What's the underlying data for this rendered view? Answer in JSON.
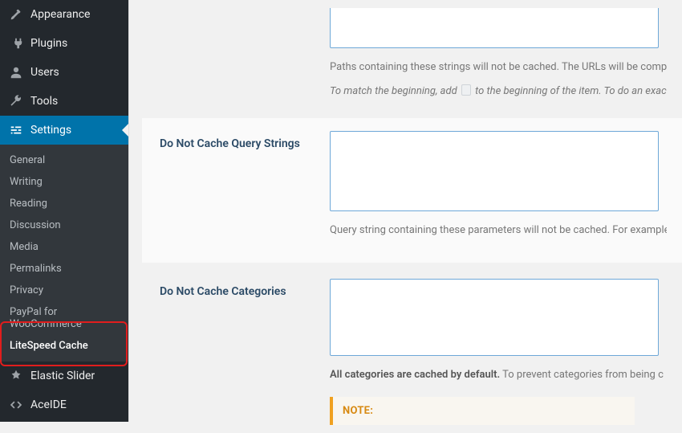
{
  "sidebar": {
    "items": [
      {
        "label": "Appearance",
        "icon": "brush"
      },
      {
        "label": "Plugins",
        "icon": "plug"
      },
      {
        "label": "Users",
        "icon": "user"
      },
      {
        "label": "Tools",
        "icon": "wrench"
      },
      {
        "label": "Settings",
        "icon": "sliders",
        "active": true
      },
      {
        "label": "Elastic Slider",
        "icon": "pin"
      },
      {
        "label": "AceIDE",
        "icon": "code"
      }
    ],
    "submenu": [
      "General",
      "Writing",
      "Reading",
      "Discussion",
      "Media",
      "Permalinks",
      "Privacy",
      "PayPal for WooCommerce",
      "LiteSpeed Cache"
    ],
    "submenu_current": "LiteSpeed Cache"
  },
  "form": {
    "row0": {
      "desc1": "Paths containing these strings will not be cached. The URLs will be compa",
      "desc2a": "To match the beginning, add ",
      "desc2b": " to the beginning of the item. To do an exact "
    },
    "row1": {
      "label": "Do Not Cache Query Strings",
      "desc": "Query string containing these parameters will not be cached. For example"
    },
    "row2": {
      "label": "Do Not Cache Categories",
      "desc_strong": "All categories are cached by default.",
      "desc_rest": " To prevent categories from being c",
      "note_title": "NOTE:"
    }
  }
}
